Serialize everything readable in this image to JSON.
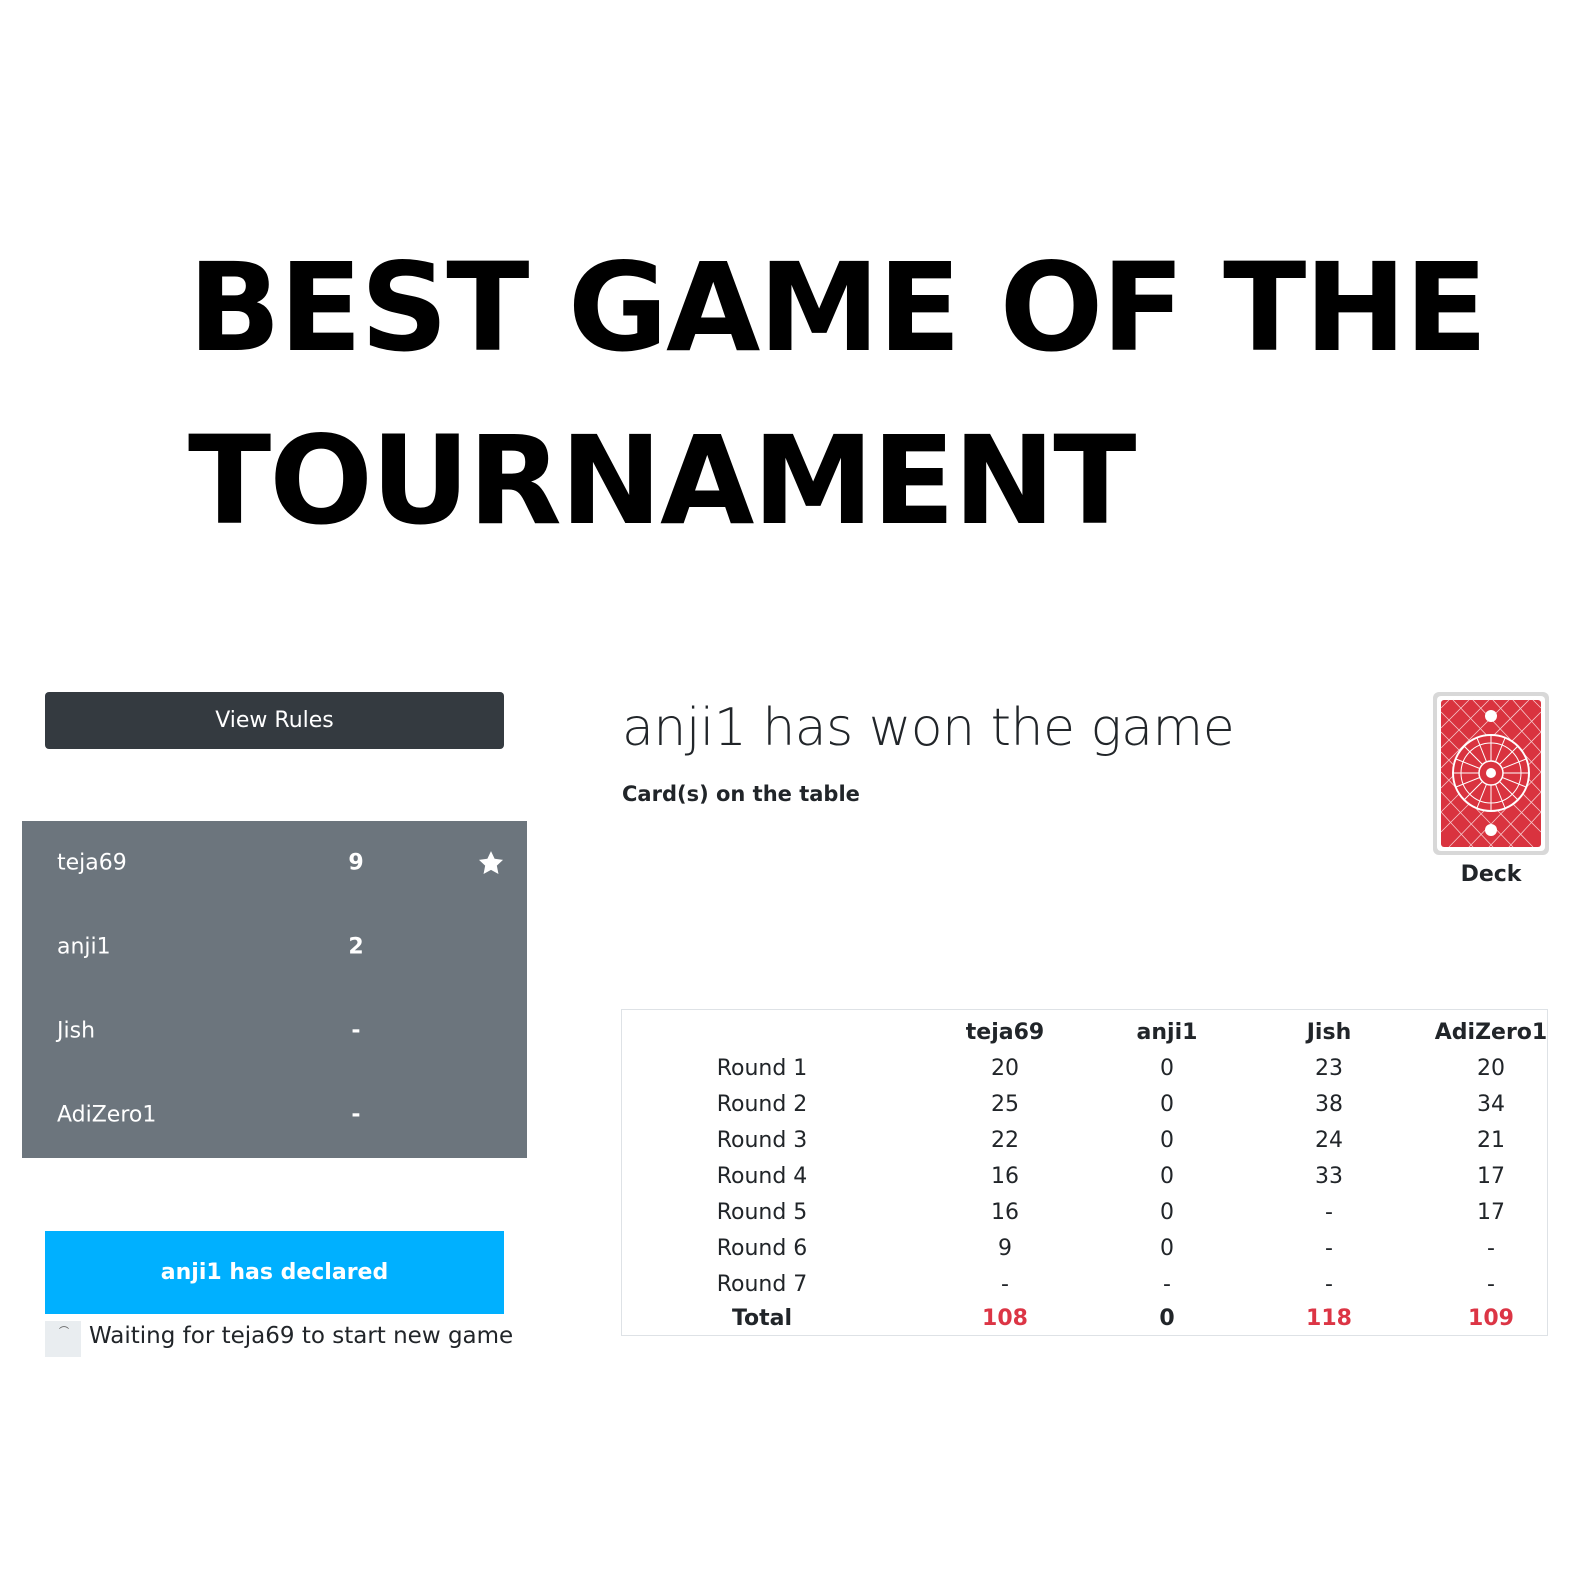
{
  "headline": {
    "line1": "BEST GAME OF THE",
    "line2": "TOURNAMENT"
  },
  "sidebar": {
    "rules_button": "View Rules",
    "players": [
      {
        "name": "teja69",
        "score": "9",
        "icon": "star-icon"
      },
      {
        "name": "anji1",
        "score": "2"
      },
      {
        "name": "Jish",
        "score": "-"
      },
      {
        "name": "AdiZero1",
        "score": "-"
      }
    ],
    "declared_banner": "anji1 has declared",
    "waiting_text": "Waiting for teja69 to start new game"
  },
  "main": {
    "won_title": "anji1 has won the game",
    "table_cards_label": "Card(s) on the table",
    "deck_label": "Deck"
  },
  "scoreboard": {
    "headers": [
      "teja69",
      "anji1",
      "Jish",
      "AdiZero1"
    ],
    "rows": [
      {
        "label": "Round 1",
        "values": [
          "20",
          "0",
          "23",
          "20"
        ]
      },
      {
        "label": "Round 2",
        "values": [
          "25",
          "0",
          "38",
          "34"
        ]
      },
      {
        "label": "Round 3",
        "values": [
          "22",
          "0",
          "24",
          "21"
        ]
      },
      {
        "label": "Round 4",
        "values": [
          "16",
          "0",
          "33",
          "17"
        ]
      },
      {
        "label": "Round 5",
        "values": [
          "16",
          "0",
          "-",
          "17"
        ]
      },
      {
        "label": "Round 6",
        "values": [
          "9",
          "0",
          "-",
          "-"
        ]
      },
      {
        "label": "Round 7",
        "values": [
          "-",
          "-",
          "-",
          "-"
        ]
      }
    ],
    "total": {
      "label": "Total",
      "values": [
        "108",
        "0",
        "118",
        "109"
      ]
    }
  },
  "colors": {
    "dark_button": "#343a40",
    "player_panel": "#6c757d",
    "declared_banner": "#00b0ff",
    "total_red": "#dc3545",
    "card_red": "#d9333f"
  }
}
